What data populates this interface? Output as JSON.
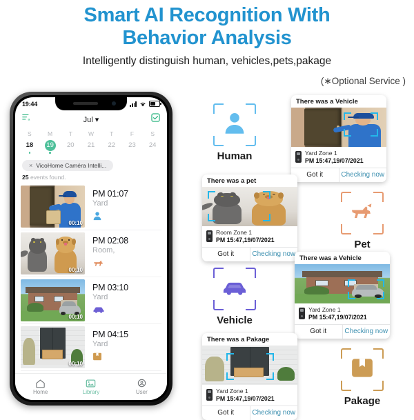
{
  "header": {
    "title_line1": "Smart AI Recognition With",
    "title_line2": "Behavior Analysis",
    "subtitle": "Intelligently distinguish human, vehicles,pets,pakage",
    "optional_note": "(∗Optional Service )",
    "title_color": "#2293cf"
  },
  "phone": {
    "status_bar": {
      "time": "19:44"
    },
    "app_bar": {
      "month": "Jul ▾",
      "left_icon": "list-filter-icon",
      "right_icon": "checkbox-select-icon",
      "accent": "#2ab37f"
    },
    "calendar": {
      "dow": [
        "S",
        "M",
        "T",
        "W",
        "T",
        "F",
        "S"
      ],
      "days": [
        "18",
        "19",
        "20",
        "21",
        "22",
        "23",
        "24"
      ],
      "selected_index": 1,
      "bold_index": 0,
      "dot_indexes": [
        0,
        1
      ],
      "highlight_color": "#4ec09a"
    },
    "filter_chip": {
      "close": "×",
      "label": "VicoHome Caméra Intelli..."
    },
    "events_found": {
      "count": "25",
      "label": "events found."
    },
    "events": [
      {
        "time": "PM 01:07",
        "zone": "Yard",
        "duration": "00:10",
        "icon": "human-icon",
        "icon_color": "#4aa7e0",
        "art": "a1"
      },
      {
        "time": "PM 02:08",
        "zone": "Room,",
        "duration": "00:10",
        "icon": "pet-icon",
        "icon_color": "#e08b5c",
        "art": "a2"
      },
      {
        "time": "PM 03:10",
        "zone": "Yard",
        "duration": "00:10",
        "icon": "vehicle-icon",
        "icon_color": "#6d5fd4",
        "art": "a3"
      },
      {
        "time": "PM 04:15",
        "zone": "Yard",
        "duration": "00:10",
        "icon": "package-icon",
        "icon_color": "#cf9a4f",
        "art": "a4"
      }
    ],
    "tabs": [
      {
        "label": "Home",
        "icon": "home-icon",
        "active": false
      },
      {
        "label": "Library",
        "icon": "library-icon",
        "active": true
      },
      {
        "label": "User",
        "icon": "user-icon",
        "active": false
      }
    ],
    "tab_active_color": "#6dbfa4"
  },
  "categories": [
    {
      "name": "Human",
      "icon": "human-icon",
      "color": "#63bdee"
    },
    {
      "name": "Pet",
      "icon": "pet-icon",
      "color": "#e79b72"
    },
    {
      "name": "Vehicle",
      "icon": "vehicle-icon",
      "color": "#6b5fd6"
    },
    {
      "name": "Pakage",
      "icon": "package-icon",
      "color": "#cc9c55"
    }
  ],
  "notifications": [
    {
      "title": "There was a Vehicle",
      "zone": "Yard Zone 1",
      "time": "PM 15:47,19/07/2021",
      "got_it": "Got it",
      "checking": "Checking now",
      "art": "a1"
    },
    {
      "title": "There was a pet",
      "zone": "Room Zone 1",
      "time": "PM 15:47,19/07/2021",
      "got_it": "Got it",
      "checking": "Checking now",
      "art": "a2"
    },
    {
      "title": "There was a Vehicle",
      "zone": "Yard Zone 1",
      "time": "PM 15:47,19/07/2021",
      "got_it": "Got it",
      "checking": "Checking now",
      "art": "a3"
    },
    {
      "title": "There was a Pakage",
      "zone": "Yard Zone 1",
      "time": "PM 15:47,19/07/2021",
      "got_it": "Got it",
      "checking": "Checking now",
      "art": "a4"
    }
  ],
  "colors": {
    "checking_now": "#3d90b0",
    "detection_bracket": "#23b7ea"
  }
}
